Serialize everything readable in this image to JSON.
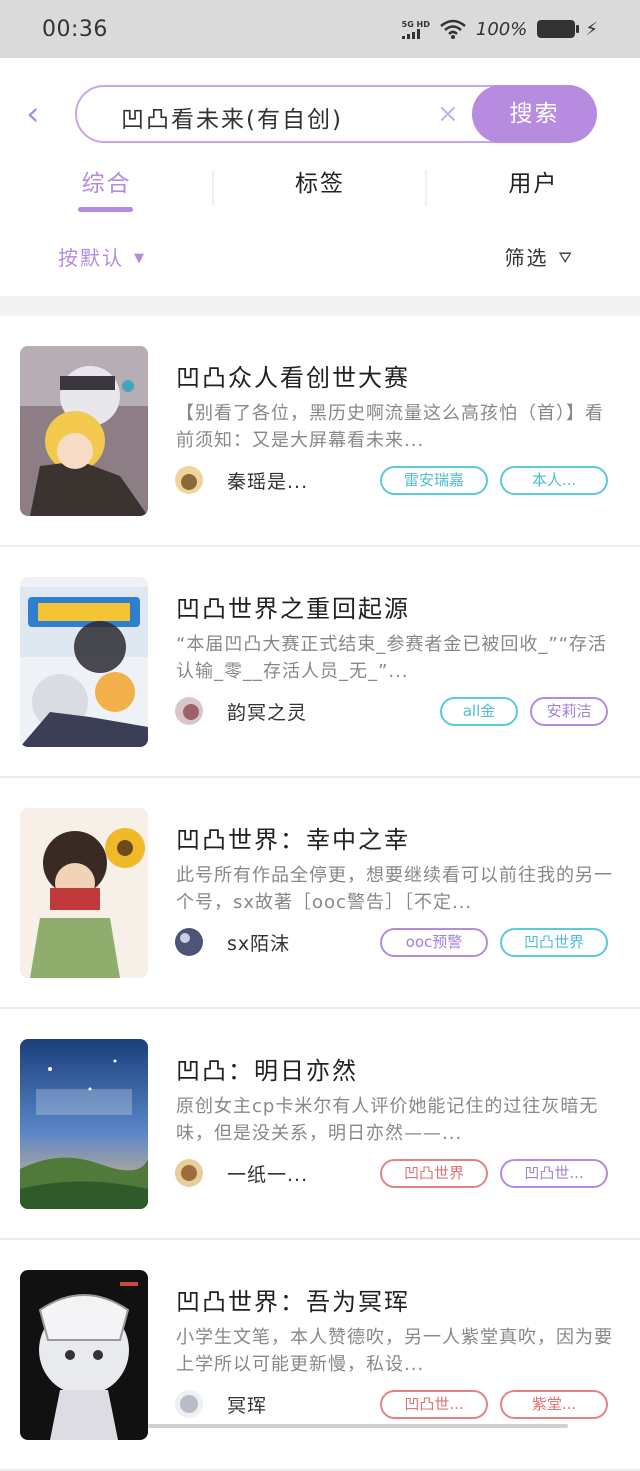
{
  "status_bar": {
    "time": "00:36",
    "network": "5G HD",
    "battery": "100%"
  },
  "search": {
    "query": "凹凸看未来(有自创)",
    "button": "搜索",
    "clear": "×",
    "back": "‹"
  },
  "tabs": [
    {
      "label": "综合",
      "active": true
    },
    {
      "label": "标签",
      "active": false
    },
    {
      "label": "用户",
      "active": false
    }
  ],
  "sort": {
    "label": "按默认",
    "arrow": "▼"
  },
  "filter": {
    "label": "筛选",
    "icon": "⛛"
  },
  "results": [
    {
      "title": "凹凸众人看创世大赛",
      "desc": "【别看了各位，黑历史啊流量这么高孩怕（首）】看前须知：又是大屏幕看未来...",
      "author": "秦瑶是...",
      "tags": [
        {
          "label": "雷安瑞嘉",
          "color": "cyan"
        },
        {
          "label": "本人...",
          "color": "cyan"
        }
      ]
    },
    {
      "title": "凹凸世界之重回起源",
      "desc": "“本届凹凸大赛正式结束_参赛者金已被回收_”“存活认输_零__存活人员_无_”...",
      "author": "韵冥之灵",
      "tags": [
        {
          "label": "all金",
          "color": "cyan"
        },
        {
          "label": "安莉洁",
          "color": "purple"
        }
      ]
    },
    {
      "title": "凹凸世界：幸中之幸",
      "desc": "此号所有作品全停更，想要继续看可以前往我的另一个号，sx故著［ooc警告］［不定...",
      "author": "sx陌沫",
      "tags": [
        {
          "label": "ooc预警",
          "color": "purple"
        },
        {
          "label": "凹凸世界",
          "color": "cyan"
        }
      ]
    },
    {
      "title": "凹凸：明日亦然",
      "desc": "原创女主cp卡米尔有人评价她能记住的过往灰暗无味，但是没关系，明日亦然——...",
      "author": "一纸一...",
      "tags": [
        {
          "label": "凹凸世界",
          "color": "red"
        },
        {
          "label": "凹凸世...",
          "color": "purple"
        }
      ]
    },
    {
      "title": "凹凸世界：吾为冥珲",
      "desc": "小学生文笔，本人赞德吹，另一人紫堂真吹，因为要上学所以可能更新慢，私设...",
      "author": "冥珲",
      "tags": [
        {
          "label": "凹凸世...",
          "color": "red"
        },
        {
          "label": "紫堂...",
          "color": "red"
        }
      ]
    }
  ]
}
